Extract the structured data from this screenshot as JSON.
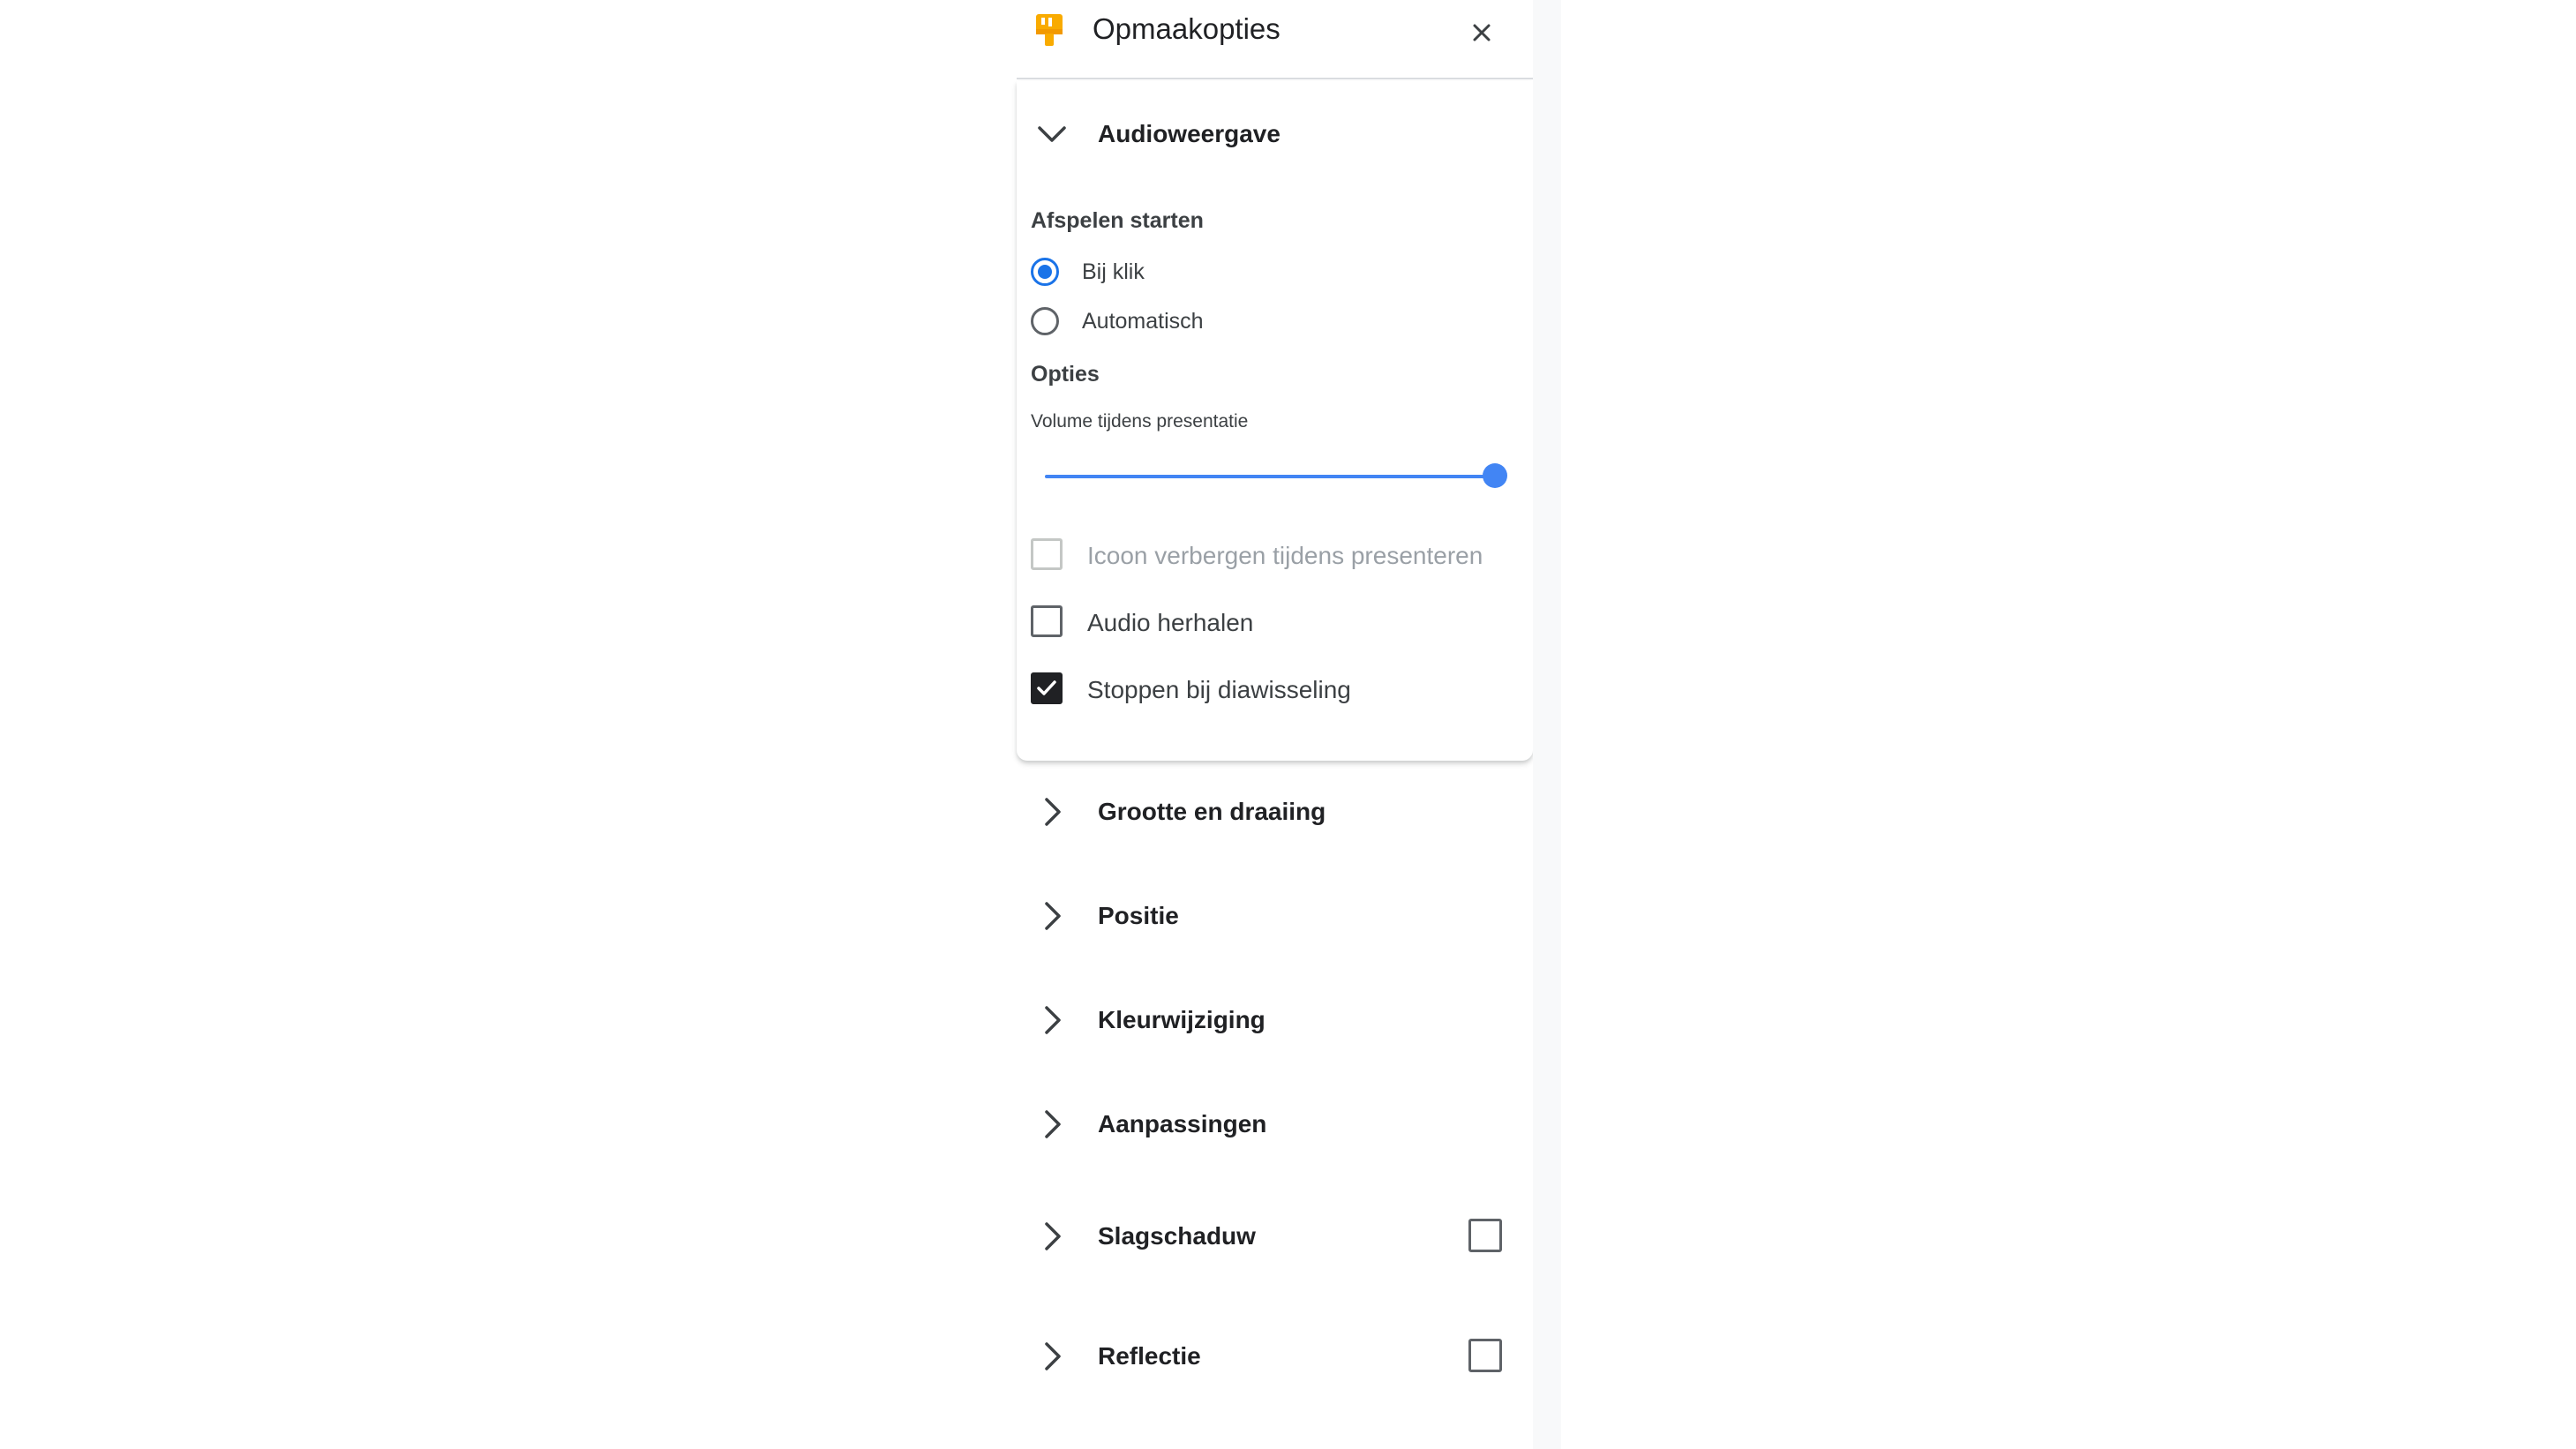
{
  "header": {
    "title": "Opmaakopties",
    "icon": "format-paint-icon",
    "close_icon": "close-icon",
    "accent_color": "#f9ab00"
  },
  "audio": {
    "section_label": "Audioweergave",
    "expanded": true,
    "playback": {
      "title": "Afspelen starten",
      "options": [
        {
          "label": "Bij klik",
          "selected": true
        },
        {
          "label": "Automatisch",
          "selected": false
        }
      ]
    },
    "options": {
      "title": "Opties",
      "volume_label": "Volume tijdens presentatie",
      "volume_level": 1.0,
      "checkboxes": [
        {
          "label": "Icoon verbergen tijdens presenteren",
          "checked": false,
          "disabled": true
        },
        {
          "label": "Audio herhalen",
          "checked": false,
          "disabled": false
        },
        {
          "label": "Stoppen bij diawisseling",
          "checked": true,
          "disabled": false
        }
      ]
    }
  },
  "sections": [
    {
      "label": "Grootte en draaiing",
      "has_checkbox": false
    },
    {
      "label": "Positie",
      "has_checkbox": false
    },
    {
      "label": "Kleurwijziging",
      "has_checkbox": false
    },
    {
      "label": "Aanpassingen",
      "has_checkbox": false
    },
    {
      "label": "Slagschaduw",
      "has_checkbox": true,
      "checked": false
    },
    {
      "label": "Reflectie",
      "has_checkbox": true,
      "checked": false
    }
  ],
  "colors": {
    "primary": "#1a73e8",
    "slider": "#4285f4",
    "text": "#202124"
  }
}
